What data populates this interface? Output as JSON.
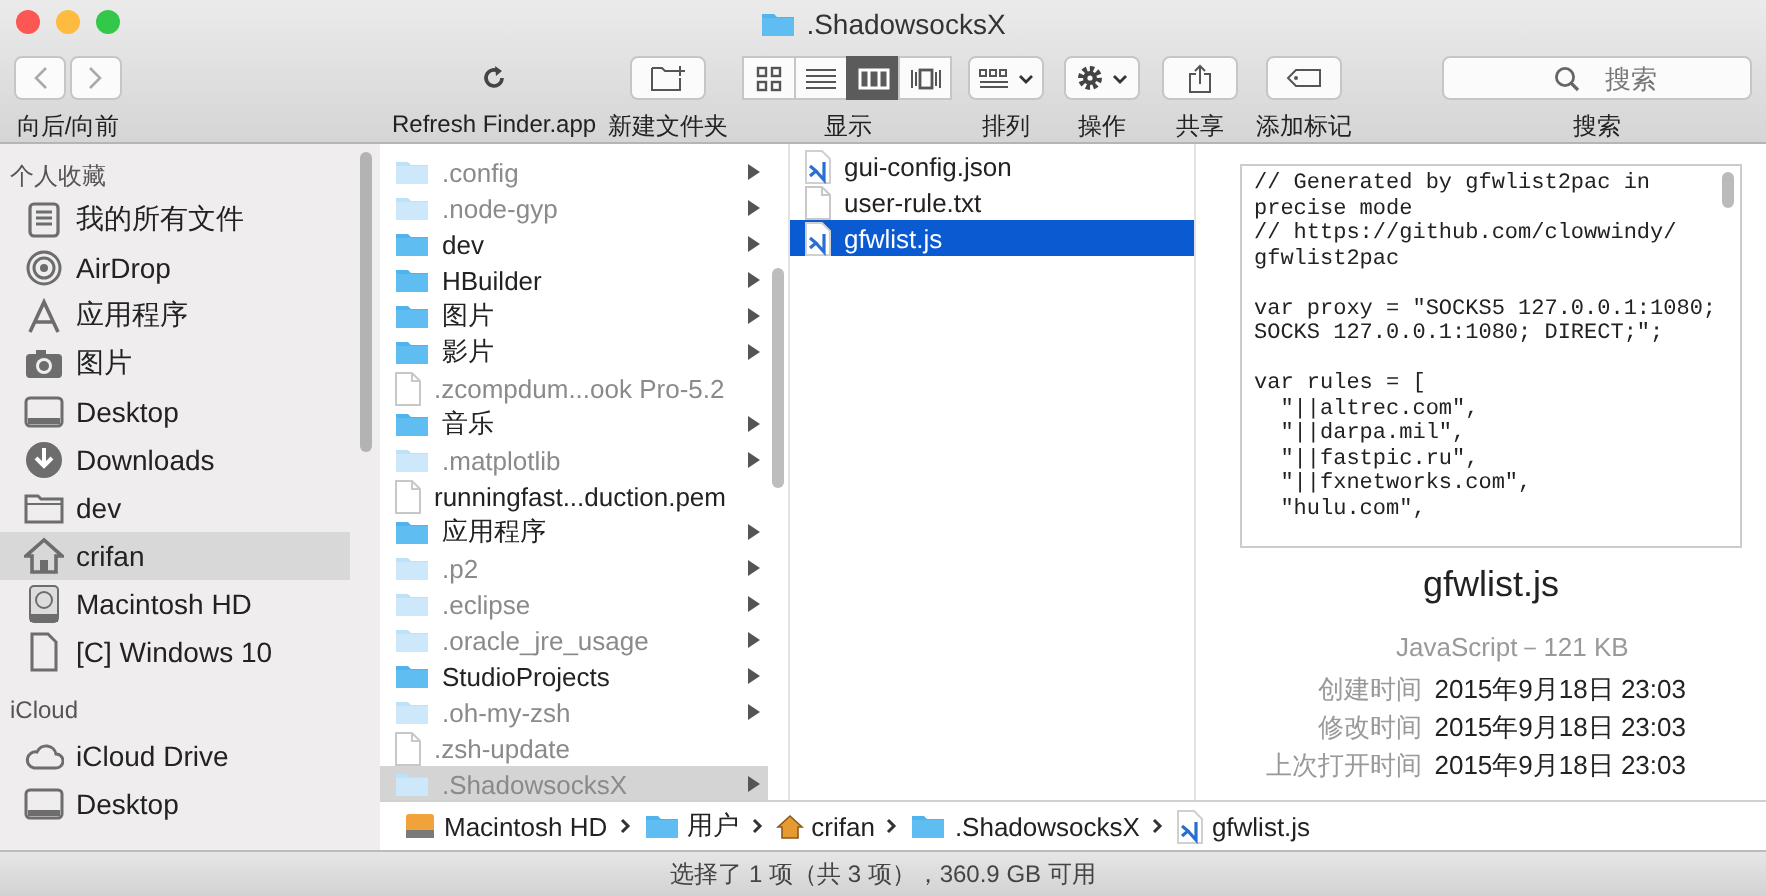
{
  "window": {
    "title": ".ShadowsocksX"
  },
  "toolbar": {
    "nav_label": "向后/向前",
    "refresh_label": "Refresh Finder.app",
    "new_folder_label": "新建文件夹",
    "view_label": "显示",
    "view_modes": [
      {
        "kind": "icons",
        "selected": false
      },
      {
        "kind": "list",
        "selected": false
      },
      {
        "kind": "columns",
        "selected": true
      },
      {
        "kind": "coverflow",
        "selected": false
      }
    ],
    "arrange_label": "排列",
    "action_label": "操作",
    "share_label": "共享",
    "tags_label": "添加标记",
    "search": {
      "placeholder": "搜索",
      "label": "搜索"
    }
  },
  "sidebar": {
    "sections": [
      {
        "title": "个人收藏",
        "items": [
          {
            "label": "我的所有文件",
            "kind": "documents",
            "selected": false
          },
          {
            "label": "AirDrop",
            "kind": "airdrop",
            "selected": false
          },
          {
            "label": "应用程序",
            "kind": "apps",
            "selected": false
          },
          {
            "label": "图片",
            "kind": "camera",
            "selected": false
          },
          {
            "label": "Desktop",
            "kind": "desktop",
            "selected": false
          },
          {
            "label": "Downloads",
            "kind": "downloads",
            "selected": false
          },
          {
            "label": "dev",
            "kind": "folder",
            "selected": false
          },
          {
            "label": "crifan",
            "kind": "home",
            "selected": true
          },
          {
            "label": "Macintosh HD",
            "kind": "disk",
            "selected": false
          },
          {
            "label": "[C] Windows 10",
            "kind": "file",
            "selected": false
          }
        ]
      },
      {
        "title": "iCloud",
        "items": [
          {
            "label": "iCloud Drive",
            "kind": "cloud",
            "selected": false
          },
          {
            "label": "Desktop",
            "kind": "desktop",
            "selected": false
          }
        ]
      }
    ]
  },
  "column_1": [
    {
      "name": ".config",
      "kind": "folder",
      "dimmed": true,
      "expandable": true,
      "selected": false
    },
    {
      "name": ".node-gyp",
      "kind": "folder",
      "dimmed": true,
      "expandable": true,
      "selected": false
    },
    {
      "name": "dev",
      "kind": "folder",
      "dimmed": false,
      "expandable": true,
      "selected": false
    },
    {
      "name": "HBuilder",
      "kind": "folder",
      "dimmed": false,
      "expandable": true,
      "selected": false
    },
    {
      "name": "图片",
      "kind": "folder",
      "dimmed": false,
      "expandable": true,
      "selected": false
    },
    {
      "name": "影片",
      "kind": "folder",
      "dimmed": false,
      "expandable": true,
      "selected": false
    },
    {
      "name": ".zcompdum...ook Pro-5.2",
      "kind": "file",
      "dimmed": true,
      "expandable": false,
      "selected": false
    },
    {
      "name": "音乐",
      "kind": "folder",
      "dimmed": false,
      "expandable": true,
      "selected": false
    },
    {
      "name": ".matplotlib",
      "kind": "folder",
      "dimmed": true,
      "expandable": true,
      "selected": false
    },
    {
      "name": "runningfast...duction.pem",
      "kind": "file",
      "dimmed": false,
      "expandable": false,
      "selected": false
    },
    {
      "name": "应用程序",
      "kind": "folder",
      "dimmed": false,
      "expandable": true,
      "selected": false
    },
    {
      "name": ".p2",
      "kind": "folder",
      "dimmed": true,
      "expandable": true,
      "selected": false
    },
    {
      "name": ".eclipse",
      "kind": "folder",
      "dimmed": true,
      "expandable": true,
      "selected": false
    },
    {
      "name": ".oracle_jre_usage",
      "kind": "folder",
      "dimmed": true,
      "expandable": true,
      "selected": false
    },
    {
      "name": "StudioProjects",
      "kind": "folder",
      "dimmed": false,
      "expandable": true,
      "selected": false
    },
    {
      "name": ".oh-my-zsh",
      "kind": "folder",
      "dimmed": true,
      "expandable": true,
      "selected": false
    },
    {
      "name": ".zsh-update",
      "kind": "file",
      "dimmed": true,
      "expandable": false,
      "selected": false
    },
    {
      "name": ".ShadowsocksX",
      "kind": "folder",
      "dimmed": true,
      "expandable": true,
      "selected": true
    }
  ],
  "column_2": [
    {
      "name": "gui-config.json",
      "kind": "code",
      "selected": false
    },
    {
      "name": "user-rule.txt",
      "kind": "file",
      "selected": false
    },
    {
      "name": "gfwlist.js",
      "kind": "code",
      "selected": true
    }
  ],
  "preview": {
    "code": "// Generated by gfwlist2pac in\nprecise mode\n// https://github.com/clowwindy/\ngfwlist2pac\n\nvar proxy = \"SOCKS5 127.0.0.1:1080;\nSOCKS 127.0.0.1:1080; DIRECT;\";\n\nvar rules = [\n  \"||altrec.com\",\n  \"||darpa.mil\",\n  \"||fastpic.ru\",\n  \"||fxnetworks.com\",\n  \"hulu.com\",",
    "name": "gfwlist.js",
    "kind_size": "JavaScript－121 KB",
    "info": [
      {
        "label": "创建时间",
        "value": "2015年9月18日 23:03"
      },
      {
        "label": "修改时间",
        "value": "2015年9月18日 23:03"
      },
      {
        "label": "上次打开时间",
        "value": "2015年9月18日 23:03"
      }
    ]
  },
  "path_bar": [
    {
      "label": "Macintosh HD",
      "kind": "disk"
    },
    {
      "label": "用户",
      "kind": "folder"
    },
    {
      "label": "crifan",
      "kind": "home"
    },
    {
      "label": ".ShadowsocksX",
      "kind": "folder"
    },
    {
      "label": "gfwlist.js",
      "kind": "code"
    }
  ],
  "status_bar": "选择了 1 项（共 3 项），360.9 GB 可用"
}
